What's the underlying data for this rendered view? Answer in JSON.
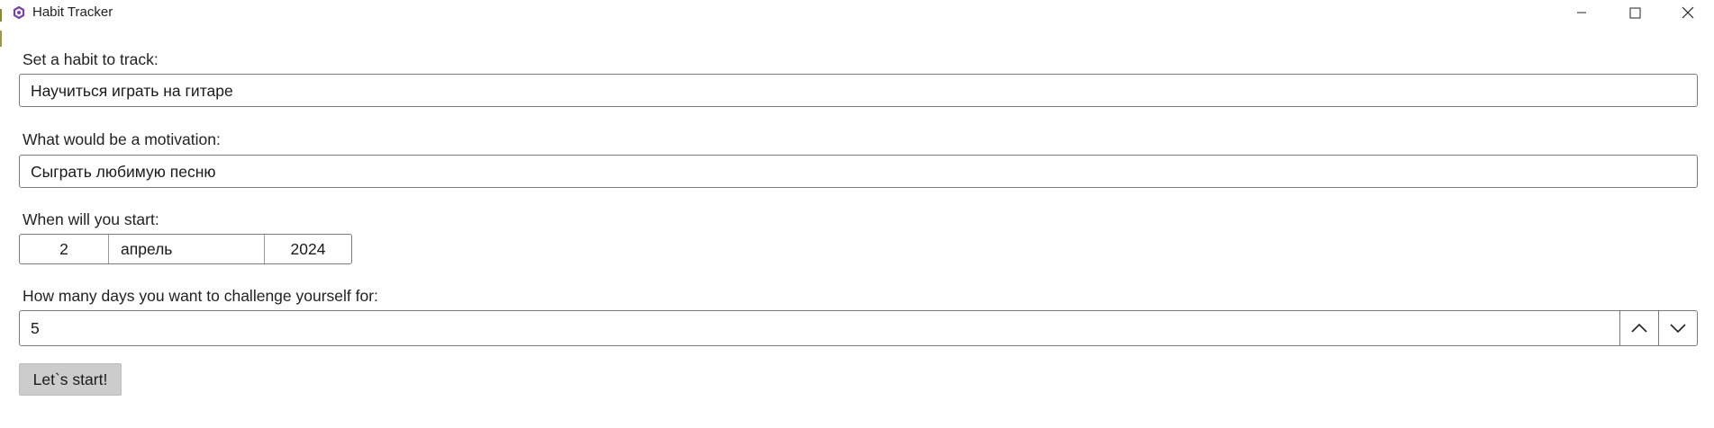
{
  "window": {
    "title": "Habit Tracker",
    "app_icon": "app-logo-icon",
    "controls": [
      "minimize-icon",
      "maximize-icon",
      "close-icon"
    ]
  },
  "form": {
    "habit": {
      "label": "Set a habit to track:",
      "value": "Научиться играть на гитаре"
    },
    "motivation": {
      "label": "What would be a motivation:",
      "value": "Сыграть любимую песню"
    },
    "start_date": {
      "label": "When will you start:",
      "day": "2",
      "month": "апрель",
      "year": "2024"
    },
    "days": {
      "label": "How many days you want to challenge yourself for:",
      "value": "5",
      "up_icon": "chevron-up-icon",
      "down_icon": "chevron-down-icon"
    },
    "submit_label": "Let`s start!"
  },
  "colors": {
    "border": "#7a7a7a",
    "button_bg": "#cccccc",
    "background": "#ffffff"
  }
}
